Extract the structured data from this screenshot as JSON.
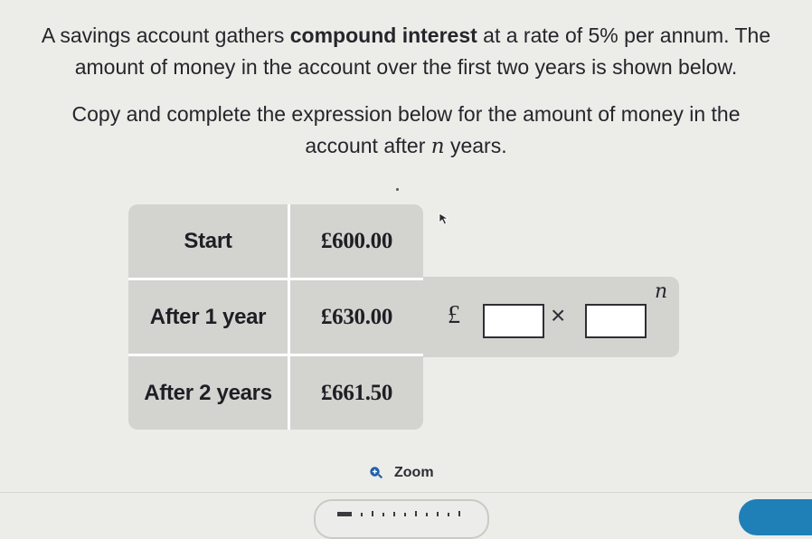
{
  "question": {
    "line1_before": "A savings account gathers ",
    "line1_bold": "compound interest",
    "line1_after": " at a rate of 5% per annum. The",
    "line2": "amount of money in the account over the first two years is shown below.",
    "line3": "Copy and complete the expression below for the amount of money in the",
    "line4_before": "account after ",
    "line4_variable": "n",
    "line4_after": " years."
  },
  "table": {
    "rows": [
      {
        "label": "Start",
        "value": "£600.00"
      },
      {
        "label": "After 1 year",
        "value": "£630.00"
      },
      {
        "label": "After 2 years",
        "value": "£661.50"
      }
    ]
  },
  "expression": {
    "currency": "£",
    "operator": "×",
    "exponent": "n"
  },
  "zoom": {
    "label": "Zoom",
    "icon": "zoom-in-icon"
  },
  "colors": {
    "background": "#ecece9",
    "cell": "#d3d3d0",
    "accent": "#1e80b6",
    "text": "#26252b"
  }
}
